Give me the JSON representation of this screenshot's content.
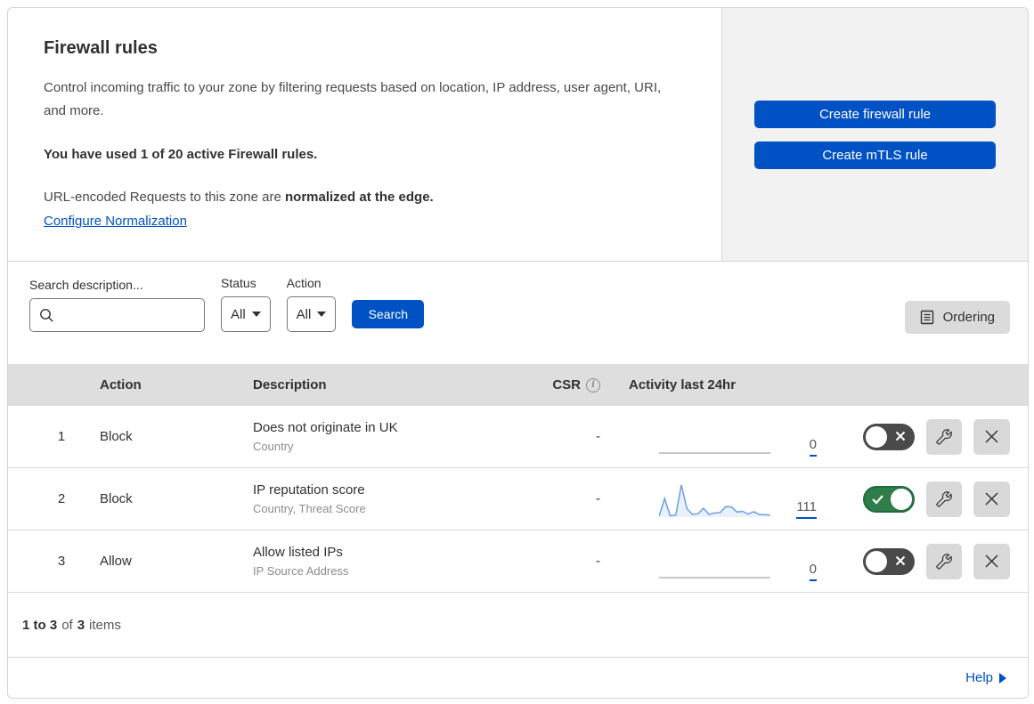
{
  "header": {
    "title": "Firewall rules",
    "description": "Control incoming traffic to your zone by filtering requests based on location, IP address, user agent, URI, and more.",
    "usage": "You have used 1 of 20 active Firewall rules.",
    "normalization_text": "URL-encoded Requests to this zone are",
    "normalization_bold": "normalized at the edge.",
    "normalization_link": "Configure Normalization",
    "create_firewall_button": "Create firewall rule",
    "create_mtls_button": "Create mTLS rule"
  },
  "filters": {
    "search_label": "Search description...",
    "status_label": "Status",
    "status_value": "All",
    "action_label": "Action",
    "action_value": "All",
    "search_button": "Search",
    "ordering_button": "Ordering"
  },
  "table": {
    "columns": {
      "action": "Action",
      "description": "Description",
      "csr": "CSR",
      "activity": "Activity last 24hr"
    },
    "rows": [
      {
        "index": "1",
        "action": "Block",
        "description": "Does not originate in UK",
        "fields": "Country",
        "csr": "-",
        "activity_count": "0",
        "enabled": false,
        "sparkline": null
      },
      {
        "index": "2",
        "action": "Block",
        "description": "IP reputation score",
        "fields": "Country, Threat Score",
        "csr": "-",
        "activity_count": "111",
        "enabled": true,
        "sparkline": [
          3,
          55,
          4,
          6,
          95,
          25,
          8,
          10,
          26,
          8,
          12,
          14,
          31,
          30,
          15,
          17,
          9,
          16,
          8,
          7,
          6
        ]
      },
      {
        "index": "3",
        "action": "Allow",
        "description": "Allow listed IPs",
        "fields": "IP Source Address",
        "csr": "-",
        "activity_count": "0",
        "enabled": false,
        "sparkline": null
      }
    ]
  },
  "pagination": {
    "range": "1 to 3",
    "of": "of",
    "total": "3",
    "items": "items"
  },
  "footer": {
    "help": "Help"
  },
  "colors": {
    "accent_blue": "#0051c3",
    "toggle_on_green": "#2e7d4a",
    "toggle_off_gray": "#4a4a4a",
    "sparkline_blue": "#6e9fe6",
    "table_header_bg": "#dedede",
    "panel_bg": "#f2f2f2"
  }
}
